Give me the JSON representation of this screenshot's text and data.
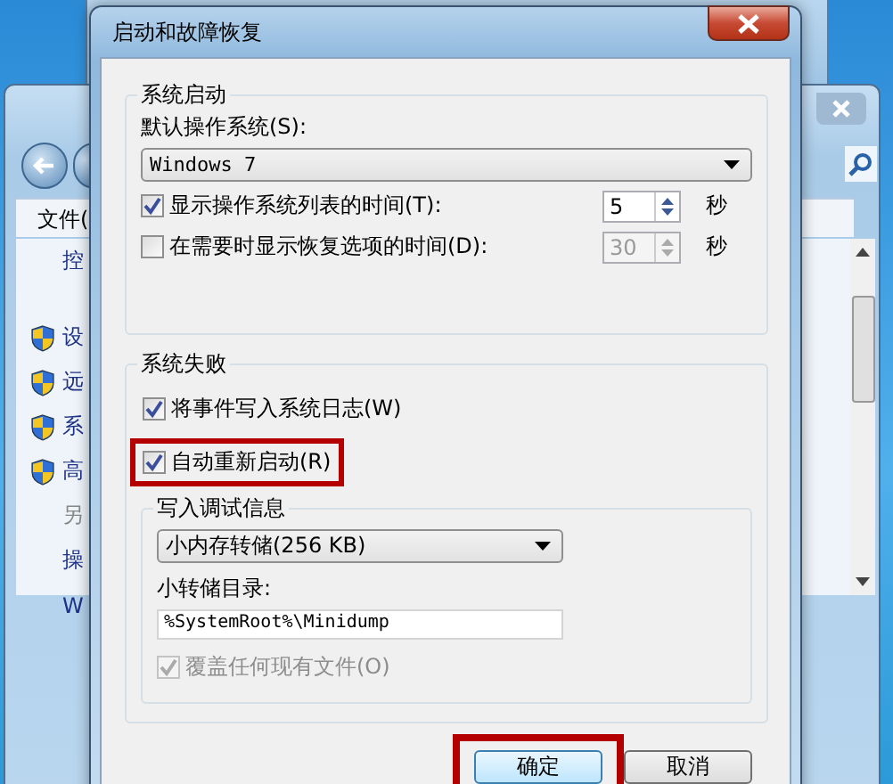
{
  "background_window": {
    "menu_item": "文件(",
    "sidebar": [
      {
        "kind": "text",
        "label": "控"
      },
      {
        "kind": "shield",
        "label": "设"
      },
      {
        "kind": "shield",
        "label": "远"
      },
      {
        "kind": "shield",
        "label": "系"
      },
      {
        "kind": "shield",
        "label": "高"
      },
      {
        "kind": "muted",
        "label": "另"
      },
      {
        "kind": "text",
        "label": "操"
      },
      {
        "kind": "text",
        "label": "W"
      }
    ]
  },
  "dialog": {
    "title": "启动和故障恢复",
    "startup": {
      "legend": "系统启动",
      "default_os_label": "默认操作系统(S):",
      "default_os": "Windows 7",
      "options": [
        {
          "label": "显示操作系统列表的时间(T):",
          "checked": true,
          "value": "5",
          "unit": "秒"
        },
        {
          "label": "在需要时显示恢复选项的时间(D):",
          "checked": false,
          "value": "30",
          "unit": "秒"
        }
      ]
    },
    "failure": {
      "legend": "系统失败",
      "options": [
        {
          "label": "将事件写入系统日志(W)",
          "checked": true,
          "highlighted": false
        },
        {
          "label": "自动重新启动(R)",
          "checked": true,
          "highlighted": true
        }
      ],
      "debug": {
        "legend": "写入调试信息",
        "dump_type": "小内存转储(256 KB)",
        "dir_label": "小转储目录:",
        "dir": "%SystemRoot%\\Minidump",
        "overwrite": {
          "label": "覆盖任何现有文件(O)",
          "checked": true,
          "disabled": true
        }
      }
    },
    "buttons": [
      {
        "label": "确定",
        "highlighted": true
      },
      {
        "label": "取消",
        "highlighted": false
      }
    ]
  }
}
